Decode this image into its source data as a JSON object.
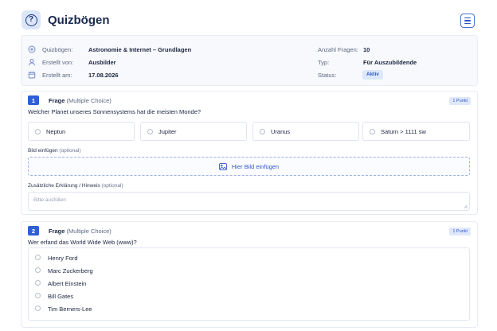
{
  "header": {
    "title": "Quizbögen",
    "logo_glyph": "?"
  },
  "info": {
    "quizboegen_label": "Quizbögen:",
    "quizboegen_value": "Astronomie & Internet – Grundlagen",
    "erstellt_von_label": "Erstellt von:",
    "erstellt_von_value": "Ausbilder",
    "erstellt_am_label": "Erstellt am:",
    "erstellt_am_value": "17.08.2026",
    "anzahl_label": "Anzahl Fragen:",
    "anzahl_value": "10",
    "typ_label": "Typ:",
    "typ_value": "Für Auszubildende",
    "status_label": "Status:",
    "status_value": "Aktiv"
  },
  "questions": [
    {
      "number": "1",
      "type_label": "Frage",
      "type_sub": "(Multiple Choice)",
      "points": "1 Punkt",
      "text": "Welcher Planet unseres Sonnensystems hat die meisten Monde?",
      "options": [
        "Neptun",
        "Jupiter",
        "Uranus",
        "Saturn > 1111 sw"
      ],
      "image_label": "Bild einfügen",
      "image_optional": "(optional)",
      "image_button": "Hier Bild einfügen",
      "hint_label": "Zusätzliche Erklärung / Hinweis",
      "hint_optional": "(optional)",
      "hint_placeholder": "Bitte ausfüllen"
    },
    {
      "number": "2",
      "type_label": "Frage",
      "type_sub": "(Multiple Choice)",
      "points": "1 Punkt",
      "text": "Wer erfand das World Wide Web (www)?",
      "options": [
        "Henry Ford",
        "Marc Zuckerberg",
        "Albert Einstein",
        "Bill Gates",
        "Tim Berners-Lee"
      ]
    }
  ],
  "colors": {
    "accent": "#2f5fd6",
    "badge_bg": "#dce8fb",
    "info_bg": "#f7f9fc"
  },
  "icons": {
    "logo": "question-circle-icon",
    "menu": "hamburger-menu-icon",
    "quiz": "plus-circle-icon",
    "creator": "user-icon",
    "date": "calendar-icon",
    "image": "image-icon",
    "resize": "resize-grip-icon"
  }
}
